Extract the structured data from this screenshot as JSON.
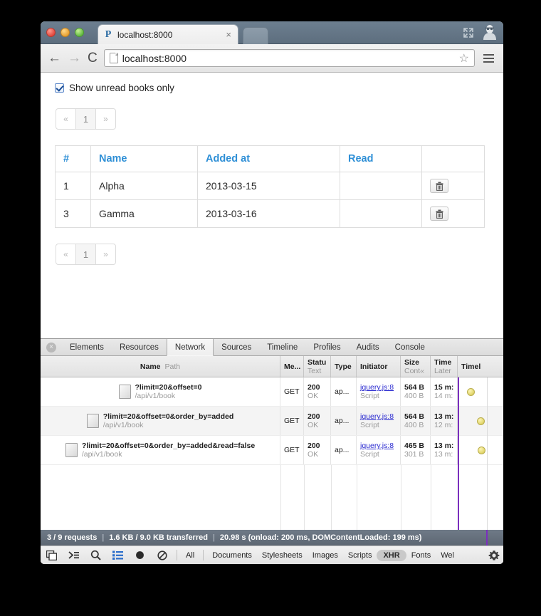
{
  "browser": {
    "tab_title": "localhost:8000",
    "favicon_glyph": "P",
    "close_glyph": "×",
    "back_glyph": "←",
    "forward_glyph": "→",
    "reload_glyph": "⟳",
    "url": "localhost:8000",
    "star_glyph": "☆"
  },
  "page": {
    "checkbox_label": "Show unread books only",
    "pagination": {
      "prev": "«",
      "page": "1",
      "next": "»"
    },
    "table": {
      "headers": [
        "#",
        "Name",
        "Added at",
        "Read",
        ""
      ],
      "rows": [
        {
          "num": "1",
          "name": "Alpha",
          "added": "2013-03-15",
          "read": ""
        },
        {
          "num": "3",
          "name": "Gamma",
          "added": "2013-03-16",
          "read": ""
        }
      ]
    }
  },
  "devtools": {
    "close_glyph": "×",
    "tabs": [
      "Elements",
      "Resources",
      "Network",
      "Sources",
      "Timeline",
      "Profiles",
      "Audits",
      "Console"
    ],
    "selected_tab": "Network",
    "columns": [
      {
        "t1": "Name",
        "t2": "Path"
      },
      {
        "t1": "Me...",
        "t2": ""
      },
      {
        "t1": "Statu",
        "t2": "Text"
      },
      {
        "t1": "Type",
        "t2": ""
      },
      {
        "t1": "Initiator",
        "t2": ""
      },
      {
        "t1": "Size",
        "t2": "Cont«"
      },
      {
        "t1": "Time",
        "t2": "Later"
      },
      {
        "t1": "Timel",
        "t2": ""
      }
    ],
    "requests": [
      {
        "name": "?limit=20&offset=0",
        "path": "/api/v1/book",
        "method": "GET",
        "status": "200",
        "status_text": "OK",
        "type": "ap...",
        "initiator": "jquery.js:8",
        "initiator_sub": "Script",
        "size": "564 B",
        "size_sub": "400 B",
        "time": "15 m:",
        "time_sub": "14 m:"
      },
      {
        "name": "?limit=20&offset=0&order_by=added",
        "path": "/api/v1/book",
        "method": "GET",
        "status": "200",
        "status_text": "OK",
        "type": "ap...",
        "initiator": "jquery.js:8",
        "initiator_sub": "Script",
        "size": "564 B",
        "size_sub": "400 B",
        "time": "13 m:",
        "time_sub": "12 m:"
      },
      {
        "name": "?limit=20&offset=0&order_by=added&read=false",
        "path": "/api/v1/book",
        "method": "GET",
        "status": "200",
        "status_text": "OK",
        "type": "ap...",
        "initiator": "jquery.js:8",
        "initiator_sub": "Script",
        "size": "465 B",
        "size_sub": "301 B",
        "time": "13 m:",
        "time_sub": "13 m:"
      }
    ],
    "status_bar": {
      "requests": "3 / 9 requests",
      "transferred": "1.6 KB / 9.0 KB transferred",
      "timing": "20.98 s (onload: 200 ms, DOMContentLoaded: 199 ms)",
      "separator": "|"
    },
    "filters": [
      "All",
      "Documents",
      "Stylesheets",
      "Images",
      "Scripts",
      "XHR",
      "Fonts",
      "Wel"
    ],
    "active_filter": "XHR"
  },
  "colors": {
    "link_blue": "#2e8fd6",
    "timeline_purple": "#7b2fbe",
    "status_bar_bg": "#5d6773",
    "marker_yellow": "#ded264"
  }
}
